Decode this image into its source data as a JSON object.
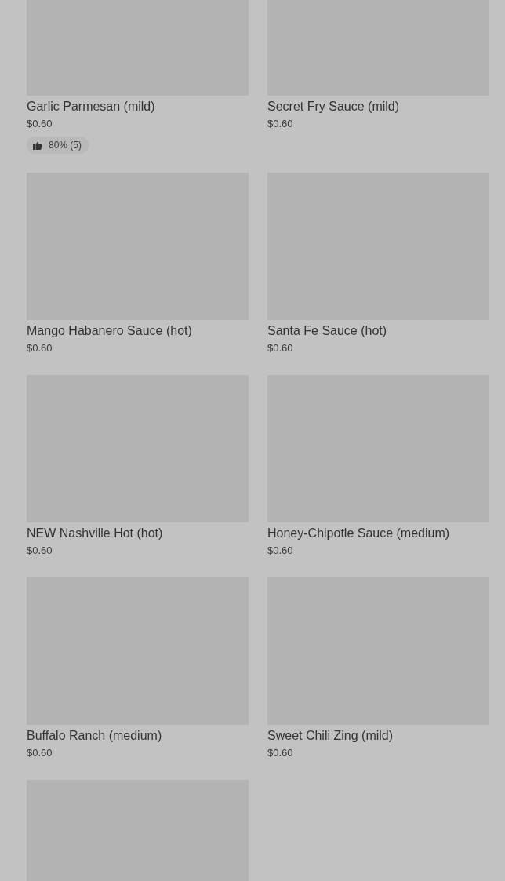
{
  "items": [
    {
      "kind": "product",
      "name": "Garlic Parmesan (mild)",
      "price": "$0.60",
      "rating": "80% (5)"
    },
    {
      "kind": "product",
      "name": "Secret Fry Sauce (mild)",
      "price": "$0.60"
    },
    {
      "kind": "product",
      "name": "Mango Habanero Sauce (hot)",
      "price": "$0.60"
    },
    {
      "kind": "product",
      "name": "Santa Fe Sauce (hot)",
      "price": "$0.60"
    },
    {
      "kind": "product",
      "name": "NEW Nashville Hot (hot)",
      "price": "$0.60"
    },
    {
      "kind": "product",
      "name": "Honey-Chipotle Sauce (medium)",
      "price": "$0.60"
    },
    {
      "kind": "product",
      "name": "Buffalo Ranch (medium)",
      "price": "$0.60"
    },
    {
      "kind": "product",
      "name": "Sweet Chili Zing (mild)",
      "price": "$0.60"
    },
    {
      "kind": "picture"
    }
  ]
}
